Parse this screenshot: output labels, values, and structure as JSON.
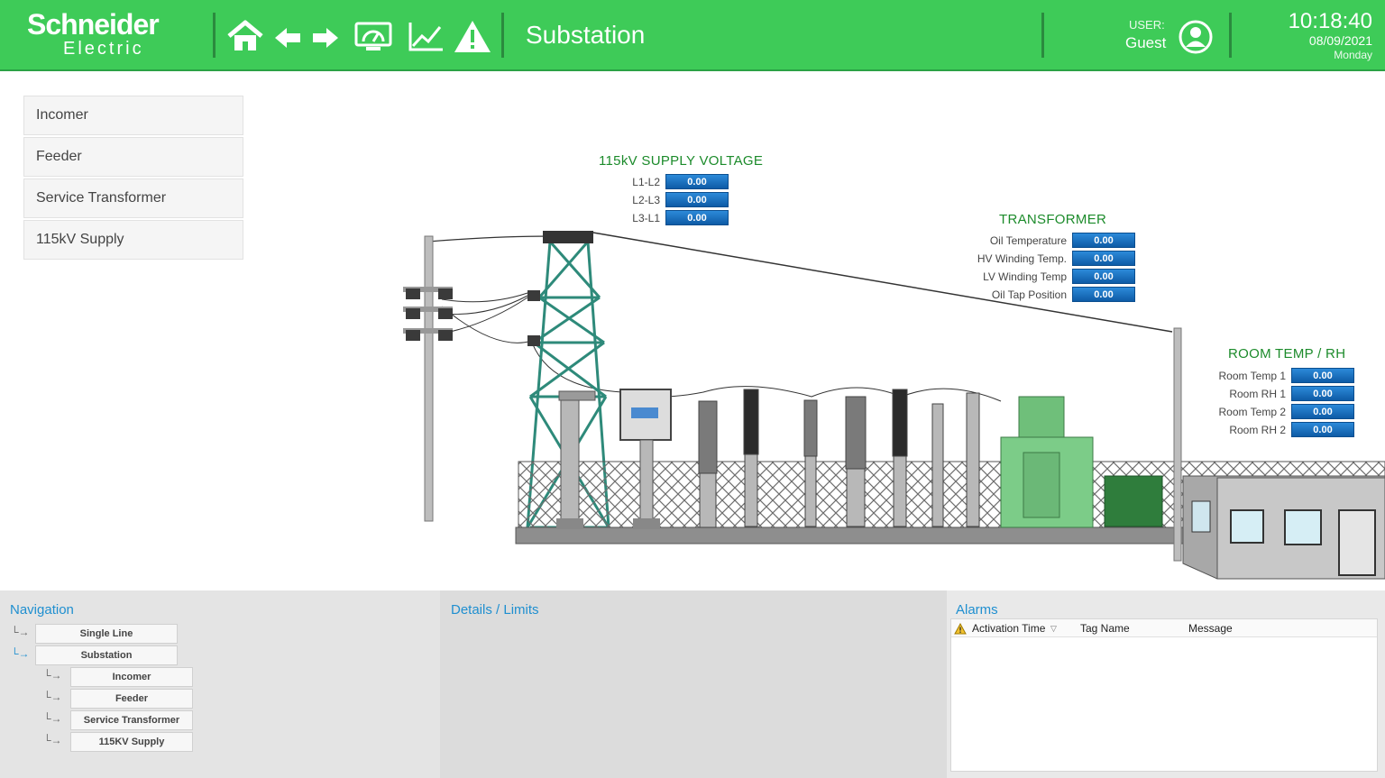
{
  "header": {
    "brand_line1": "Schneider",
    "brand_line2": "Electric",
    "title": "Substation",
    "user_label": "USER:",
    "user_name": "Guest",
    "time": "10:18:40",
    "date": "08/09/2021",
    "weekday": "Monday",
    "icons": [
      "home-icon",
      "back-arrow-icon",
      "forward-arrow-icon",
      "dashboard-icon",
      "trend-chart-icon",
      "alarm-warning-icon"
    ]
  },
  "sidebar": {
    "items": [
      {
        "label": "Incomer"
      },
      {
        "label": "Feeder"
      },
      {
        "label": "Service Transformer"
      },
      {
        "label": "115kV Supply"
      }
    ]
  },
  "supply_voltage": {
    "title": "115kV SUPPLY VOLTAGE",
    "rows": [
      {
        "label": "L1-L2",
        "value": "0.00"
      },
      {
        "label": "L2-L3",
        "value": "0.00"
      },
      {
        "label": "L3-L1",
        "value": "0.00"
      }
    ]
  },
  "transformer": {
    "title": "TRANSFORMER",
    "rows": [
      {
        "label": "Oil Temperature",
        "value": "0.00"
      },
      {
        "label": "HV Winding Temp.",
        "value": "0.00"
      },
      {
        "label": "LV Winding Temp",
        "value": "0.00"
      },
      {
        "label": "Oil Tap Position",
        "value": "0.00"
      }
    ]
  },
  "room": {
    "title": "ROOM TEMP / RH",
    "rows": [
      {
        "label": "Room Temp 1",
        "value": "0.00"
      },
      {
        "label": "Room RH 1",
        "value": "0.00"
      },
      {
        "label": "Room Temp 2",
        "value": "0.00"
      },
      {
        "label": "Room RH 2",
        "value": "0.00"
      }
    ]
  },
  "navigation": {
    "title": "Navigation",
    "items": [
      {
        "label": "Single Line"
      },
      {
        "label": "Substation"
      },
      {
        "label": "Incomer"
      },
      {
        "label": "Feeder"
      },
      {
        "label": "Service Transformer"
      },
      {
        "label": "115KV Supply"
      }
    ]
  },
  "details": {
    "title": "Details / Limits"
  },
  "alarms": {
    "title": "Alarms",
    "columns": [
      "Activation Time",
      "Tag Name",
      "Message"
    ]
  },
  "colors": {
    "header_green": "#3ecb58",
    "value_blue": "#1a6fc2",
    "section_title_green": "#1c8b2b",
    "panel_title_blue": "#1f8fd0"
  }
}
